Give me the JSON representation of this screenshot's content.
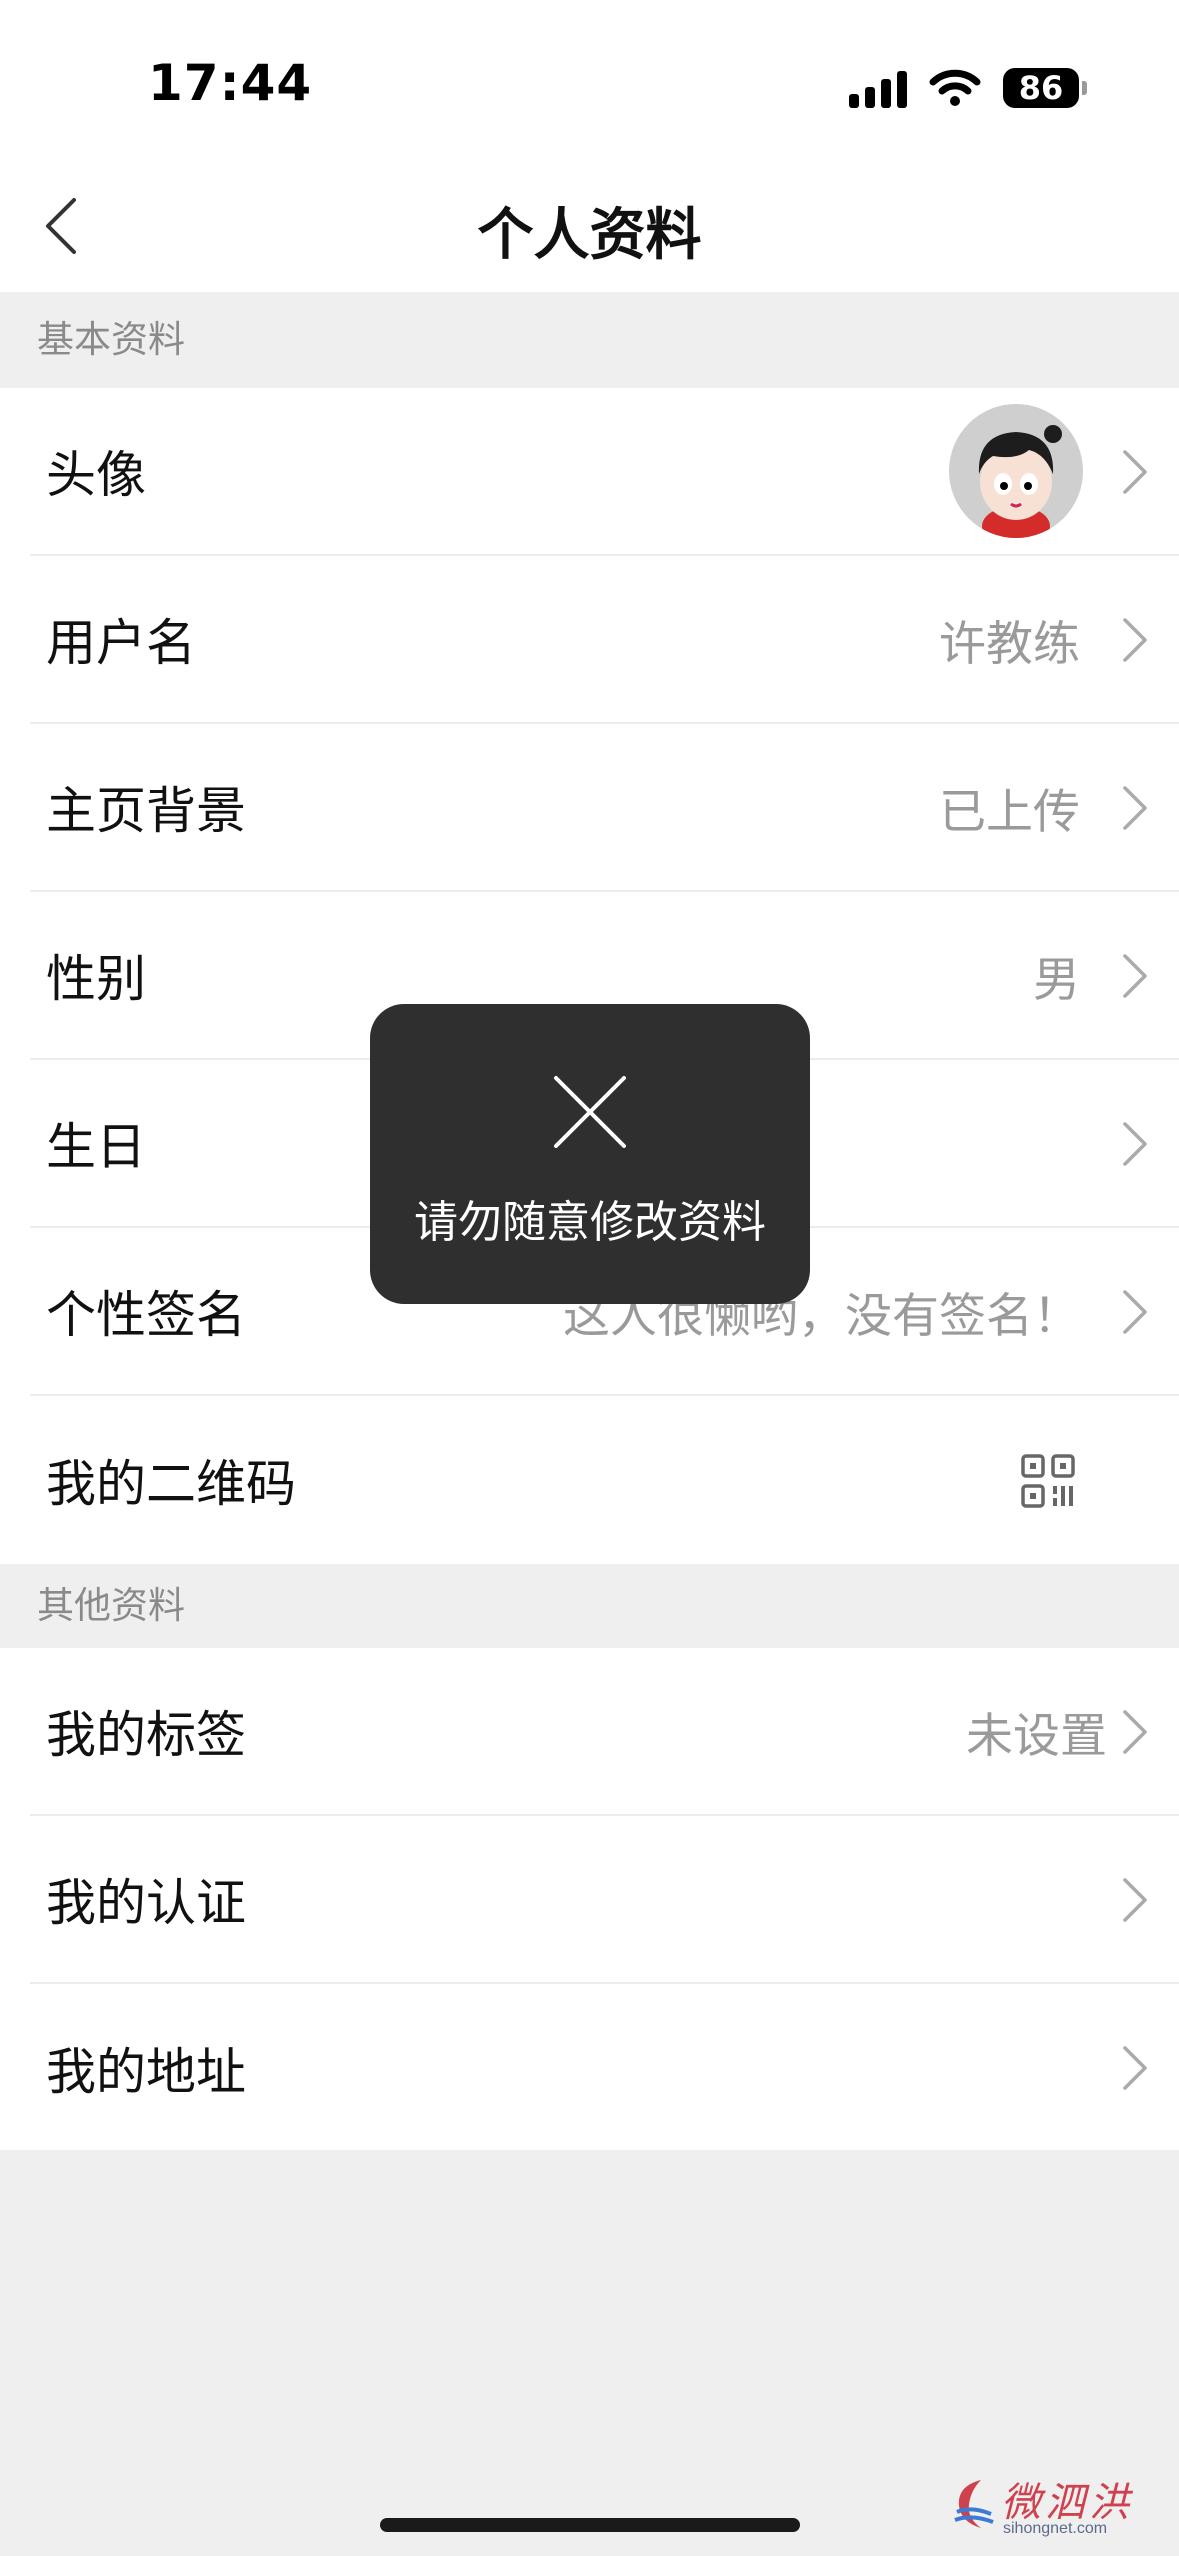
{
  "status_bar": {
    "time": "17:44",
    "battery": "86"
  },
  "nav": {
    "title": "个人资料"
  },
  "sections": {
    "basic_header": "基本资料",
    "other_header": "其他资料"
  },
  "basic_rows": [
    {
      "label": "头像"
    },
    {
      "label": "用户名",
      "value": "许教练"
    },
    {
      "label": "主页背景",
      "value": "已上传"
    },
    {
      "label": "性别",
      "value": "男"
    },
    {
      "label": "生日",
      "value": ""
    },
    {
      "label": "个性签名",
      "value": "这人很懒哟，没有签名！"
    },
    {
      "label": "我的二维码"
    }
  ],
  "other_rows": [
    {
      "label": "我的标签",
      "value": "未设置"
    },
    {
      "label": "我的认证"
    },
    {
      "label": "我的地址"
    }
  ],
  "toast": {
    "message": "请勿随意修改资料",
    "icon": "close-x-icon"
  },
  "watermark": {
    "brand": "微泗洪",
    "url": "sihongnet.com"
  },
  "colors": {
    "toast_bg": "#2f2f2f",
    "secondary_text": "#9a9a9a",
    "background": "#efefef",
    "watermark": "#d0414e"
  }
}
